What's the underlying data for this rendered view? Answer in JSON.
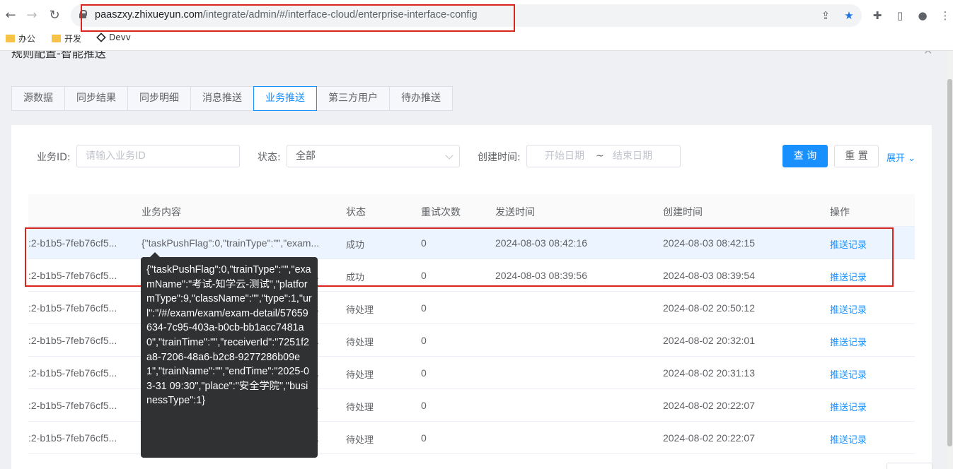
{
  "browser": {
    "url_host": "paaszxy.zhixueyun.com",
    "url_path": "/integrate/admin/#/interface-cloud/enterprise-interface-config",
    "bookmarks": [
      {
        "label": "办公",
        "icon": "folder-icon"
      },
      {
        "label": "开发",
        "icon": "folder-icon"
      },
      {
        "label": "Devv",
        "icon": "cube-icon"
      }
    ]
  },
  "dialog": {
    "title": "规则配置-智能推送"
  },
  "tabs": [
    {
      "label": "源数据"
    },
    {
      "label": "同步结果"
    },
    {
      "label": "同步明细"
    },
    {
      "label": "消息推送"
    },
    {
      "label": "业务推送",
      "active": true
    },
    {
      "label": "第三方用户"
    },
    {
      "label": "待办推送"
    }
  ],
  "filters": {
    "business_id_label": "业务ID:",
    "business_id_placeholder": "请输入业务ID",
    "status_label": "状态:",
    "status_value": "全部",
    "created_label": "创建时间:",
    "start_placeholder": "开始日期",
    "range_sep": "~",
    "end_placeholder": "结束日期",
    "query_label": "查 询",
    "reset_label": "重 置",
    "expand_label": "展开"
  },
  "table": {
    "headers": [
      "业务内容",
      "状态",
      "重试次数",
      "发送时间",
      "创建时间",
      "操作"
    ],
    "rows": [
      {
        "id": ":2-b1b5-7feb76cf5...",
        "content": "{\"taskPushFlag\":0,\"trainType\":\"\",\"exam...",
        "status": "成功",
        "retries": "0",
        "sent": "2024-08-03 08:42:16",
        "created": "2024-08-03 08:42:15",
        "action": "推送记录"
      },
      {
        "id": ":2-b1b5-7feb76cf5...",
        "content": "{\"taskPushFlag\":0,\"trainType\":\"\",\"exam...",
        "status": "成功",
        "retries": "0",
        "sent": "2024-08-03 08:39:56",
        "created": "2024-08-03 08:39:54",
        "action": "推送记录"
      },
      {
        "id": ":2-b1b5-7feb76cf5...",
        "content": "{\"taskPushFlag\":0,\"trainType\":\"\",\"exam...",
        "status": "待处理",
        "retries": "0",
        "sent": "",
        "created": "2024-08-02 20:50:12",
        "action": "推送记录"
      },
      {
        "id": ":2-b1b5-7feb76cf5...",
        "content": "{\"taskPushFlag\":0,\"trainType\":\"\",\"exam...",
        "status": "待处理",
        "retries": "0",
        "sent": "",
        "created": "2024-08-02 20:32:01",
        "action": "推送记录"
      },
      {
        "id": ":2-b1b5-7feb76cf5...",
        "content": "{\"taskPushFlag\":0,\"trainType\":\"\",\"exam...",
        "status": "待处理",
        "retries": "0",
        "sent": "",
        "created": "2024-08-02 20:31:13",
        "action": "推送记录"
      },
      {
        "id": ":2-b1b5-7feb76cf5...",
        "content": "{\"taskPushFlag\":0,\"trainType\":\"\",\"exam...",
        "status": "待处理",
        "retries": "0",
        "sent": "",
        "created": "2024-08-02 20:22:07",
        "action": "推送记录"
      },
      {
        "id": ":2-b1b5-7feb76cf5...",
        "content": "{\"taskPushFlag\":0,\"trainType\":\"\",\"exam...",
        "status": "待处理",
        "retries": "0",
        "sent": "",
        "created": "2024-08-02 20:22:07",
        "action": "推送记录"
      }
    ]
  },
  "tooltip": {
    "text": "{\"taskPushFlag\":0,\"trainType\":\"\",\"examName\":\"考试-知学云-测试\",\"platformType\":9,\"className\":\"\",\"type\":1,\"url\":\"/#/exam/exam/exam-detail/57659634-7c95-403a-b0cb-bb1acc7481a0\",\"trainTime\":\"\",\"receiverId\":\"7251f2a8-7206-48a6-b2c8-9277286b09e1\",\"trainName\":\"\",\"endTime\":\"2025-03-31 09:30\",\"place\":\"安全学院\",\"businessType\":1}"
  },
  "colors": {
    "accent": "#1890ff",
    "highlight": "#d9251d",
    "tooltip_bg": "#303133"
  }
}
